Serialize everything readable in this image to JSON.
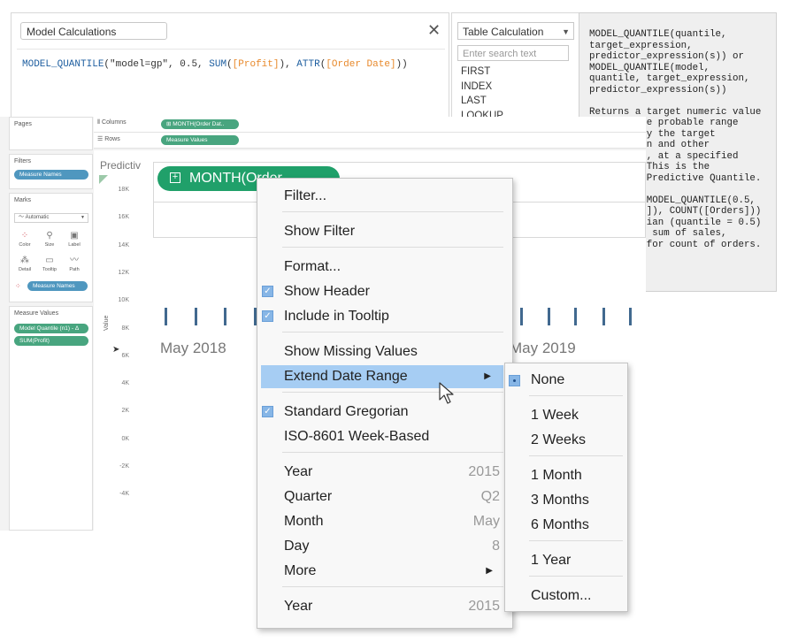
{
  "calc": {
    "name": "Model Calculations",
    "formula": {
      "fn1": "MODEL_QUANTILE",
      "args1": "(\"model=gp\", 0.5, ",
      "fn2": "SUM",
      "p1": "(",
      "fld1": "[Profit]",
      "p2": "), ",
      "fn3": "ATTR",
      "p3": "(",
      "fld2": "[Order Date]",
      "p4": "))"
    }
  },
  "functions": {
    "category": "Table Calculation",
    "search_placeholder": "Enter search text",
    "items": [
      "FIRST",
      "INDEX",
      "LAST",
      "LOOKUP"
    ]
  },
  "doc": {
    "lines": [
      "MODEL_QUANTILE(quantile,",
      "target_expression,",
      "predictor_expression(s)) or",
      "MODEL_QUANTILE(model,",
      "quantile, target_expression,",
      "predictor_expression(s))",
      "",
      "Returns a target numeric value",
      "          e probable range",
      "          y the target",
      "          n and other",
      "          , at a specified",
      "          This is the",
      "          Predictive Quantile.",
      "",
      "          MODEL_QUANTILE(0.5,",
      "          ]), COUNT([Orders]))",
      "          ian (quantile = 0.5)",
      "           sum of sales,",
      "          for count of orders."
    ]
  },
  "workspace": {
    "pages_label": "Pages",
    "filters_label": "Filters",
    "filter_pill": "Measure Names",
    "marks_label": "Marks",
    "mark_type": "Automatic",
    "mark_buttons": [
      "Color",
      "Size",
      "Label",
      "Detail",
      "Tooltip",
      "Path"
    ],
    "marks_pill": "Measure Names",
    "measure_values_label": "Measure Values",
    "measure_pill_1": "Model Quantile (n1) - Δ",
    "measure_pill_2": "SUM(Profit)",
    "columns_label": "Columns",
    "columns_pill": "MONTH(Order Dat..",
    "rows_label": "Rows",
    "rows_pill": "Measure Values",
    "viz_title": "Predictiv",
    "month_pill": "MONTH(Order",
    "axis_title": "Value",
    "y_ticks": [
      "18K",
      "16K",
      "14K",
      "12K",
      "10K",
      "8K",
      "6K",
      "4K",
      "2K",
      "0K",
      "-2K",
      "-4K"
    ],
    "x_labels": [
      "May 2018",
      "May 2019"
    ]
  },
  "context_menu": {
    "filter": "Filter...",
    "show_filter": "Show Filter",
    "format": "Format...",
    "show_header": "Show Header",
    "include_tooltip": "Include in Tooltip",
    "show_missing": "Show Missing Values",
    "extend_range": "Extend Date Range",
    "standard_gregorian": "Standard Gregorian",
    "iso_week": "ISO-8601 Week-Based",
    "year_label": "Year",
    "year_value": "2015",
    "quarter_label": "Quarter",
    "quarter_value": "Q2",
    "month_label": "Month",
    "month_value": "May",
    "day_label": "Day",
    "day_value": "8",
    "more_label": "More",
    "year2_label": "Year",
    "year2_value": "2015"
  },
  "submenu": {
    "none": "None",
    "week1": "1 Week",
    "weeks2": "2 Weeks",
    "month1": "1 Month",
    "months3": "3 Months",
    "months6": "6 Months",
    "year1": "1 Year",
    "custom": "Custom..."
  },
  "colors": {
    "pill_green": "#20a06a",
    "pill_blue": "#4f97bf",
    "menu_highlight": "#a6cdf3",
    "tick_blue": "#41698f",
    "field_orange": "#e8892b",
    "function_blue": "#1f5fa0"
  }
}
